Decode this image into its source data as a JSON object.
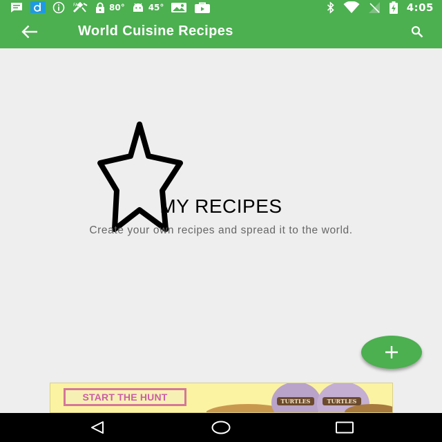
{
  "status_bar": {
    "icons": [
      "message-icon",
      "dictionary-app-icon",
      "info-icon",
      "satellite-icon",
      "lock-icon",
      "android-icon",
      "photos-icon",
      "briefcase-icon",
      "bluetooth-icon",
      "wifi-icon",
      "no-sim-icon",
      "battery-charging-icon"
    ],
    "temp_1": "80°",
    "temp_2": "45°",
    "time": "4:05"
  },
  "app_bar": {
    "title": "World Cuisine Recipes",
    "back_icon": "arrow-left-icon",
    "search_icon": "search-icon"
  },
  "empty_state": {
    "icon": "star-outline-icon",
    "title": "MY RECIPES",
    "subtitle": "Create your own recipes and spread it to the world."
  },
  "fab": {
    "icon": "plus-icon"
  },
  "ad": {
    "cta": "START THE HUNT",
    "brand": "TURTLES"
  },
  "nav_bar": {
    "icons": [
      "nav-back-icon",
      "nav-home-icon",
      "nav-recents-icon"
    ]
  },
  "colors": {
    "primary": "#4caf50",
    "background": "#eeeeee",
    "ad_background": "#fbf3a2",
    "ad_cta_text": "#cc5da8"
  }
}
